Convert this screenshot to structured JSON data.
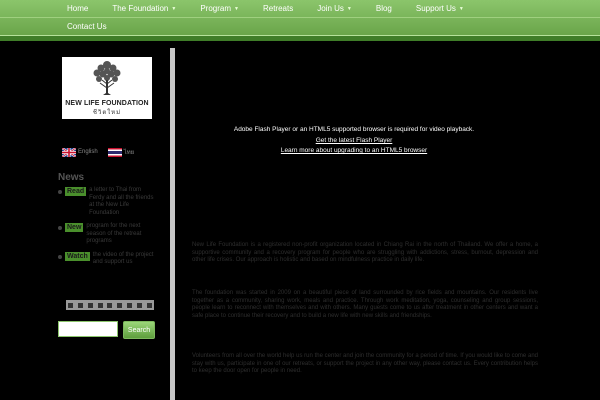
{
  "nav": {
    "items": [
      {
        "label": "Home",
        "has_submenu": false
      },
      {
        "label": "The Foundation",
        "has_submenu": true
      },
      {
        "label": "Program",
        "has_submenu": true
      },
      {
        "label": "Retreats",
        "has_submenu": false
      },
      {
        "label": "Join Us",
        "has_submenu": true
      },
      {
        "label": "Blog",
        "has_submenu": false
      },
      {
        "label": "Support Us",
        "has_submenu": true
      }
    ],
    "second_row": [
      {
        "label": "Contact Us",
        "has_submenu": false
      }
    ],
    "caret": "▼"
  },
  "sidebar": {
    "logo_text": "NEW LIFE FOUNDATION",
    "logo_thai": "ชีวิตใหม่",
    "languages": [
      {
        "label": "English",
        "flag": "uk-flag-icon"
      },
      {
        "label": "ไทย",
        "flag": "thai-flag-icon"
      }
    ],
    "news_heading": "News",
    "news_items": [
      {
        "tag": "Read",
        "text": "a letter to Thai from Ferdy and all the friends at the New Life Foundation"
      },
      {
        "tag": "New",
        "text": "program for the next season of the retreat programs"
      },
      {
        "tag": "Watch",
        "text": "the video of the project and support us"
      }
    ],
    "search": {
      "placeholder": "",
      "button_label": "Search"
    }
  },
  "main": {
    "flash_message": "Adobe Flash Player or an HTML5 supported browser is required for video playback.",
    "flash_link_1": "Get the latest Flash Player",
    "flash_link_2": "Learn more about upgrading to an HTML5 browser",
    "paragraphs": [
      "New Life Foundation is a registered non-profit organization located in Chiang Rai in the north of Thailand. We offer a home, a supportive community and a recovery program for people who are struggling with addictions, stress, burnout, depression and other life crises. Our approach is holistic and based on mindfulness practice in daily life.",
      "The foundation was started in 2009 on a beautiful piece of land surrounded by rice fields and mountains. Our residents live together as a community, sharing work, meals and practice. Through work meditation, yoga, counseling and group sessions, people learn to reconnect with themselves and with others. Many guests come to us after treatment in other centers and want a safe place to continue their recovery and to build a new life with new skills and friendships.",
      "Volunteers from all over the world help us run the center and join the community for a period of time. If you would like to come and stay with us, participate in one of our retreats, or support the project in any other way, please contact us. Every contribution helps to keep the door open for people in need."
    ]
  },
  "colors": {
    "nav_bg": "#7bb75b",
    "nav_band": "#3f7d28",
    "accent_green": "#4a8f2c",
    "page_bg": "#000000",
    "divider": "#c7c7c7"
  }
}
